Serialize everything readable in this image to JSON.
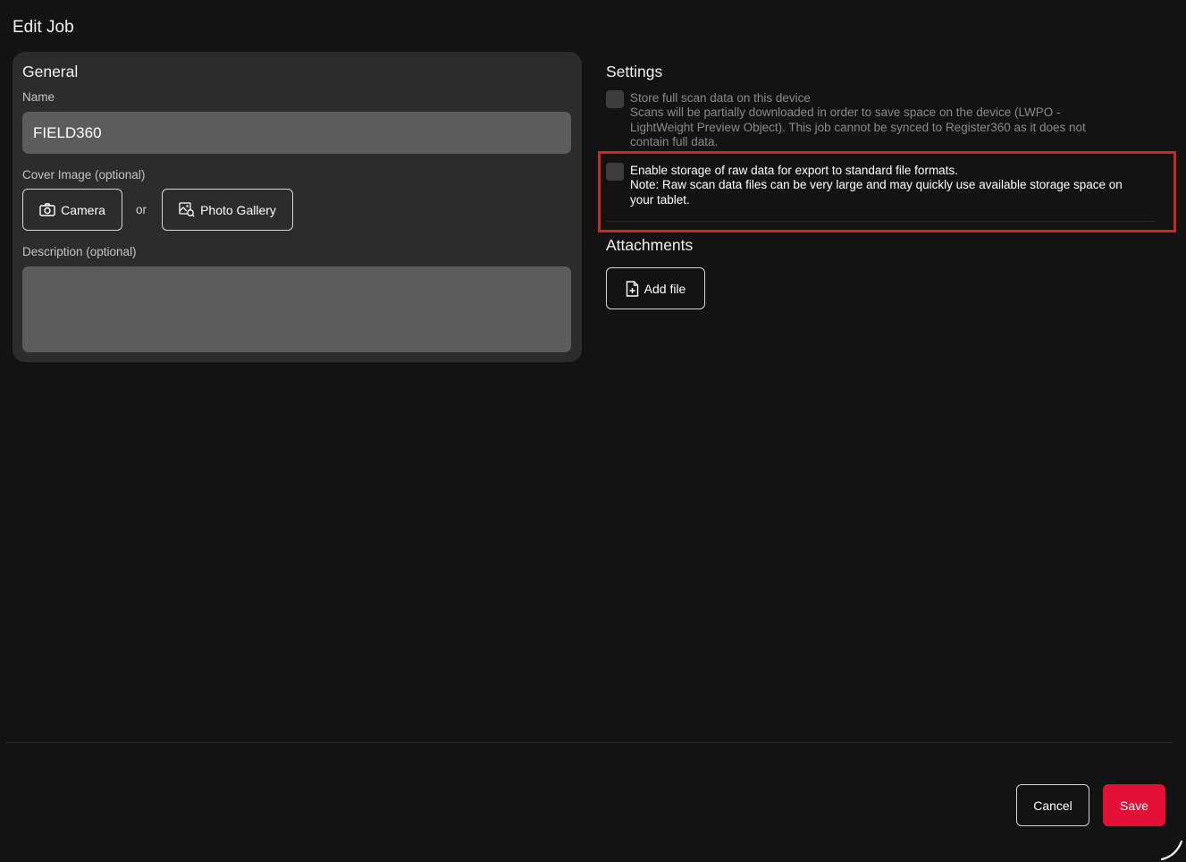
{
  "page": {
    "title": "Edit Job"
  },
  "general": {
    "title": "General",
    "name_label": "Name",
    "name_value": "FIELD360",
    "cover_label": "Cover Image (optional)",
    "camera_label": "Camera",
    "camera_icon": "camera-icon",
    "or_label": "or",
    "gallery_label": "Photo Gallery",
    "gallery_icon": "photo-gallery-icon",
    "description_label": "Description (optional)",
    "description_value": ""
  },
  "settings": {
    "title": "Settings",
    "items": [
      {
        "checked": false,
        "enabled": false,
        "line1": "Store full scan data on this device",
        "line2": "Scans will be partially downloaded in order to save space on the device (LWPO -",
        "line3": "LightWeight Preview Object). This job cannot be synced to Register360 as it does not",
        "line4": "contain full data."
      },
      {
        "checked": false,
        "enabled": true,
        "line1": "Enable storage of raw data for export to standard file formats.",
        "line2": "Note: Raw scan data files can be very large and may quickly use available storage space on",
        "line3": "your tablet."
      }
    ]
  },
  "attachments": {
    "title": "Attachments",
    "add_file_label": "Add file",
    "add_file_icon": "add-file-icon"
  },
  "footer": {
    "cancel_label": "Cancel",
    "save_label": "Save"
  },
  "colors": {
    "background": "#131313",
    "card": "#2c2c2c",
    "field": "#5c5c5c",
    "save_accent": "#e30f35",
    "highlight": "#c62a2a"
  }
}
